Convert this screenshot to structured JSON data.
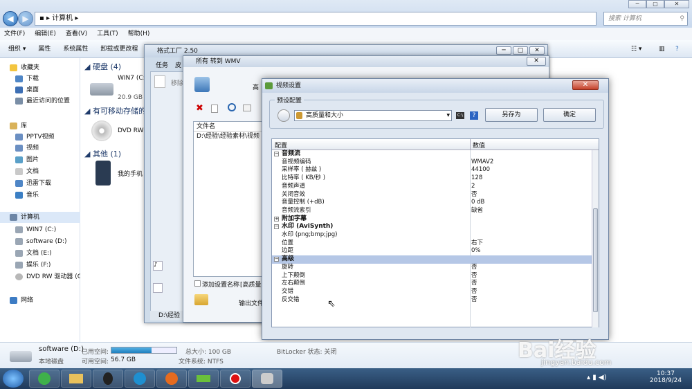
{
  "explorer": {
    "address_path": "计算机",
    "search_placeholder": "搜索 计算机",
    "menu": [
      "文件(F)",
      "编辑(E)",
      "查看(V)",
      "工具(T)",
      "帮助(H)"
    ],
    "toolbar": [
      "组织 ▾",
      "属性",
      "系统属性",
      "卸载或更改程"
    ],
    "nav": {
      "favorites": "收藏夹",
      "downloads": "下载",
      "desktop": "桌面",
      "recent": "最近访问的位置",
      "library": "库",
      "pptv": "PPTV视频",
      "videos": "视频",
      "pictures": "图片",
      "documents": "文档",
      "thunder": "迅雷下载",
      "music": "音乐",
      "computer": "计算机",
      "win7": "WIN7 (C:)",
      "software": "software (D:)",
      "docs_e": "文档 (E:)",
      "ent_f": "娱乐 (F:)",
      "dvd": "DVD RW 驱动器 (G",
      "network": "网络"
    },
    "groups": {
      "hdd": "硬盘 (4)",
      "removable": "有可移动存储的",
      "other": "其他 (1)"
    },
    "drives": {
      "c_name": "WIN7 (C:",
      "c_size": "20.9 GB",
      "dvd": "DVD RW",
      "phone": "我的手机"
    },
    "details": {
      "name": "software (D:)",
      "type": "本地磁盘",
      "used_label": "已用空间:",
      "used_fraction": 0.62,
      "free_label": "可用空间:",
      "free_value": "56.7 GB",
      "total_label": "总大小: 100 GB",
      "fs_label": "文件系统: NTFS",
      "bitlocker": "BitLocker 状态: 关闭"
    }
  },
  "ff": {
    "title": "格式工厂 2.50",
    "tab1": "任务",
    "tab2": "皮",
    "move": "移除",
    "status_path": "D:\\经验"
  },
  "wmv": {
    "title": "所有 转到 WMV",
    "hint": "高",
    "col_filename": "文件名",
    "file_path": "D:\\经验\\经验素材\\视频",
    "add_setting": "添加设置名称",
    "add_setting_value": "[高质量]",
    "output_folder": "输出文件"
  },
  "vs": {
    "title": "视频设置",
    "preset_group": "预设配置",
    "preset_value": "高质量和大小",
    "save_as": "另存为",
    "ok": "确定",
    "col_config": "配置",
    "col_value": "数值",
    "rows": [
      {
        "type": "cat",
        "toggle": "−",
        "name": "音频流",
        "value": ""
      },
      {
        "type": "item",
        "name": "音视频编码",
        "value": "WMAV2"
      },
      {
        "type": "item",
        "name": "采样率 ( 赫兹 )",
        "value": "44100"
      },
      {
        "type": "item",
        "name": "比特率 ( KB/秒 )",
        "value": "128"
      },
      {
        "type": "item",
        "name": "音频声道",
        "value": "2"
      },
      {
        "type": "item",
        "name": "关闭音效",
        "value": "否"
      },
      {
        "type": "item",
        "name": "音量控制 (+dB)",
        "value": "0 dB"
      },
      {
        "type": "item",
        "name": "音频流索引",
        "value": "缺省"
      },
      {
        "type": "cat",
        "toggle": "+",
        "name": "附加字幕",
        "value": ""
      },
      {
        "type": "cat",
        "toggle": "−",
        "name": "水印 (AviSynth)",
        "value": ""
      },
      {
        "type": "item",
        "name": "水印 (png;bmp;jpg)",
        "value": ""
      },
      {
        "type": "item",
        "name": "位置",
        "value": "右下"
      },
      {
        "type": "item",
        "name": "边距",
        "value": "0%"
      },
      {
        "type": "cat",
        "toggle": "−",
        "name": "高级",
        "value": "",
        "selected": true
      },
      {
        "type": "item",
        "name": "旋转",
        "value": "否"
      },
      {
        "type": "item",
        "name": "上下颠倒",
        "value": "否"
      },
      {
        "type": "item",
        "name": "左右颠倒",
        "value": "否"
      },
      {
        "type": "item",
        "name": "交错",
        "value": "否"
      },
      {
        "type": "item",
        "name": "反交错",
        "value": "否"
      }
    ]
  },
  "taskbar": {
    "time": "10:37",
    "date": "2018/9/24"
  },
  "watermark": {
    "brand": "Bai经验",
    "url": "jingyan.baidu.com"
  }
}
